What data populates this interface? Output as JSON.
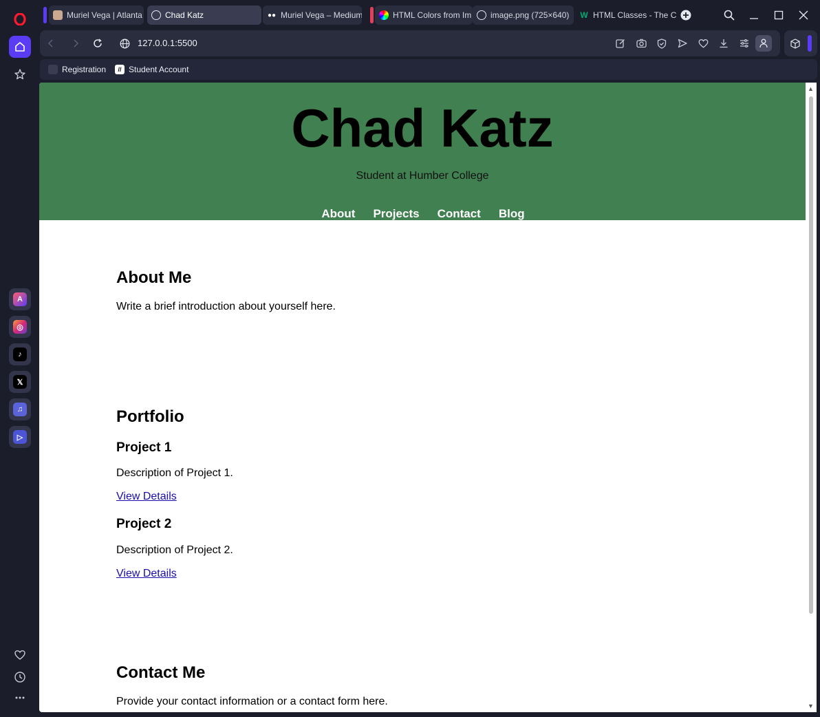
{
  "browser": {
    "tabs": [
      {
        "title": "Muriel Vega | Atlanta",
        "active": false
      },
      {
        "title": "Chad Katz",
        "active": true
      },
      {
        "title": "Muriel Vega – Medium",
        "active": false
      },
      {
        "title": "HTML Colors from Im",
        "active": false
      },
      {
        "title": "image.png (725×640)",
        "active": false
      },
      {
        "title": "HTML Classes - The C",
        "active": false
      }
    ],
    "url": "127.0.0.1:5500",
    "bookmarks": [
      {
        "label": "Registration"
      },
      {
        "label": "Student Account"
      }
    ],
    "colors": {
      "chrome_bg": "#1b1d2b",
      "accent": "#5b3cf5",
      "tab_group_red": "#e0405c"
    }
  },
  "page": {
    "header": {
      "title": "Chad Katz",
      "subtitle": "Student at Humber College",
      "bg_color": "#418050"
    },
    "nav": [
      "About",
      "Projects",
      "Contact",
      "Blog"
    ],
    "about": {
      "heading": "About Me",
      "text": "Write a brief introduction about yourself here."
    },
    "portfolio": {
      "heading": "Portfolio",
      "projects": [
        {
          "title": "Project 1",
          "description": "Description of Project 1.",
          "link": "View Details"
        },
        {
          "title": "Project 2",
          "description": "Description of Project 2.",
          "link": "View Details"
        }
      ]
    },
    "contact": {
      "heading": "Contact Me",
      "text": "Provide your contact information or a contact form here."
    }
  }
}
